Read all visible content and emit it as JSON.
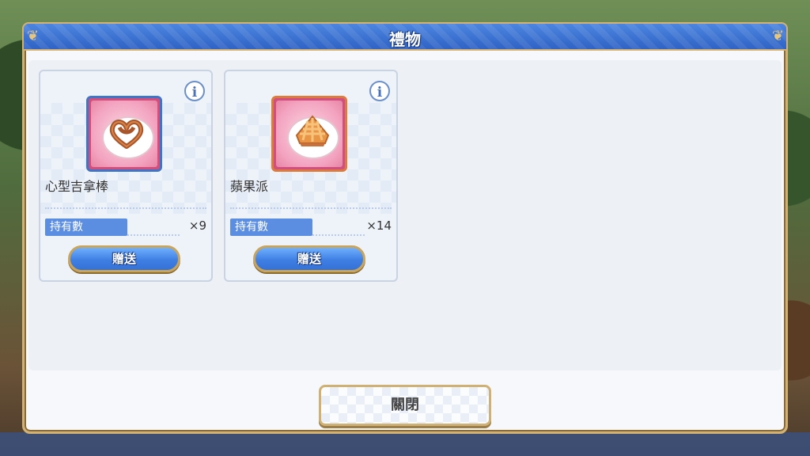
{
  "dialog": {
    "title": "禮物",
    "close_label": "關閉"
  },
  "gifts": [
    {
      "name": "心型吉拿棒",
      "qty_label": "持有數",
      "qty_value": "×9",
      "give_label": "贈送",
      "icon": "pretzel-churro-icon",
      "frame_color": "#3f74c7"
    },
    {
      "name": "蘋果派",
      "qty_label": "持有數",
      "qty_value": "×14",
      "give_label": "贈送",
      "icon": "apple-pie-icon",
      "frame_color": "#de7a3d"
    }
  ],
  "colors": {
    "title_bar": "#2f62c4",
    "gold_border": "#d2b274",
    "button_blue": "#3f7fe3",
    "qty_label_bg": "#5b8ee0"
  }
}
